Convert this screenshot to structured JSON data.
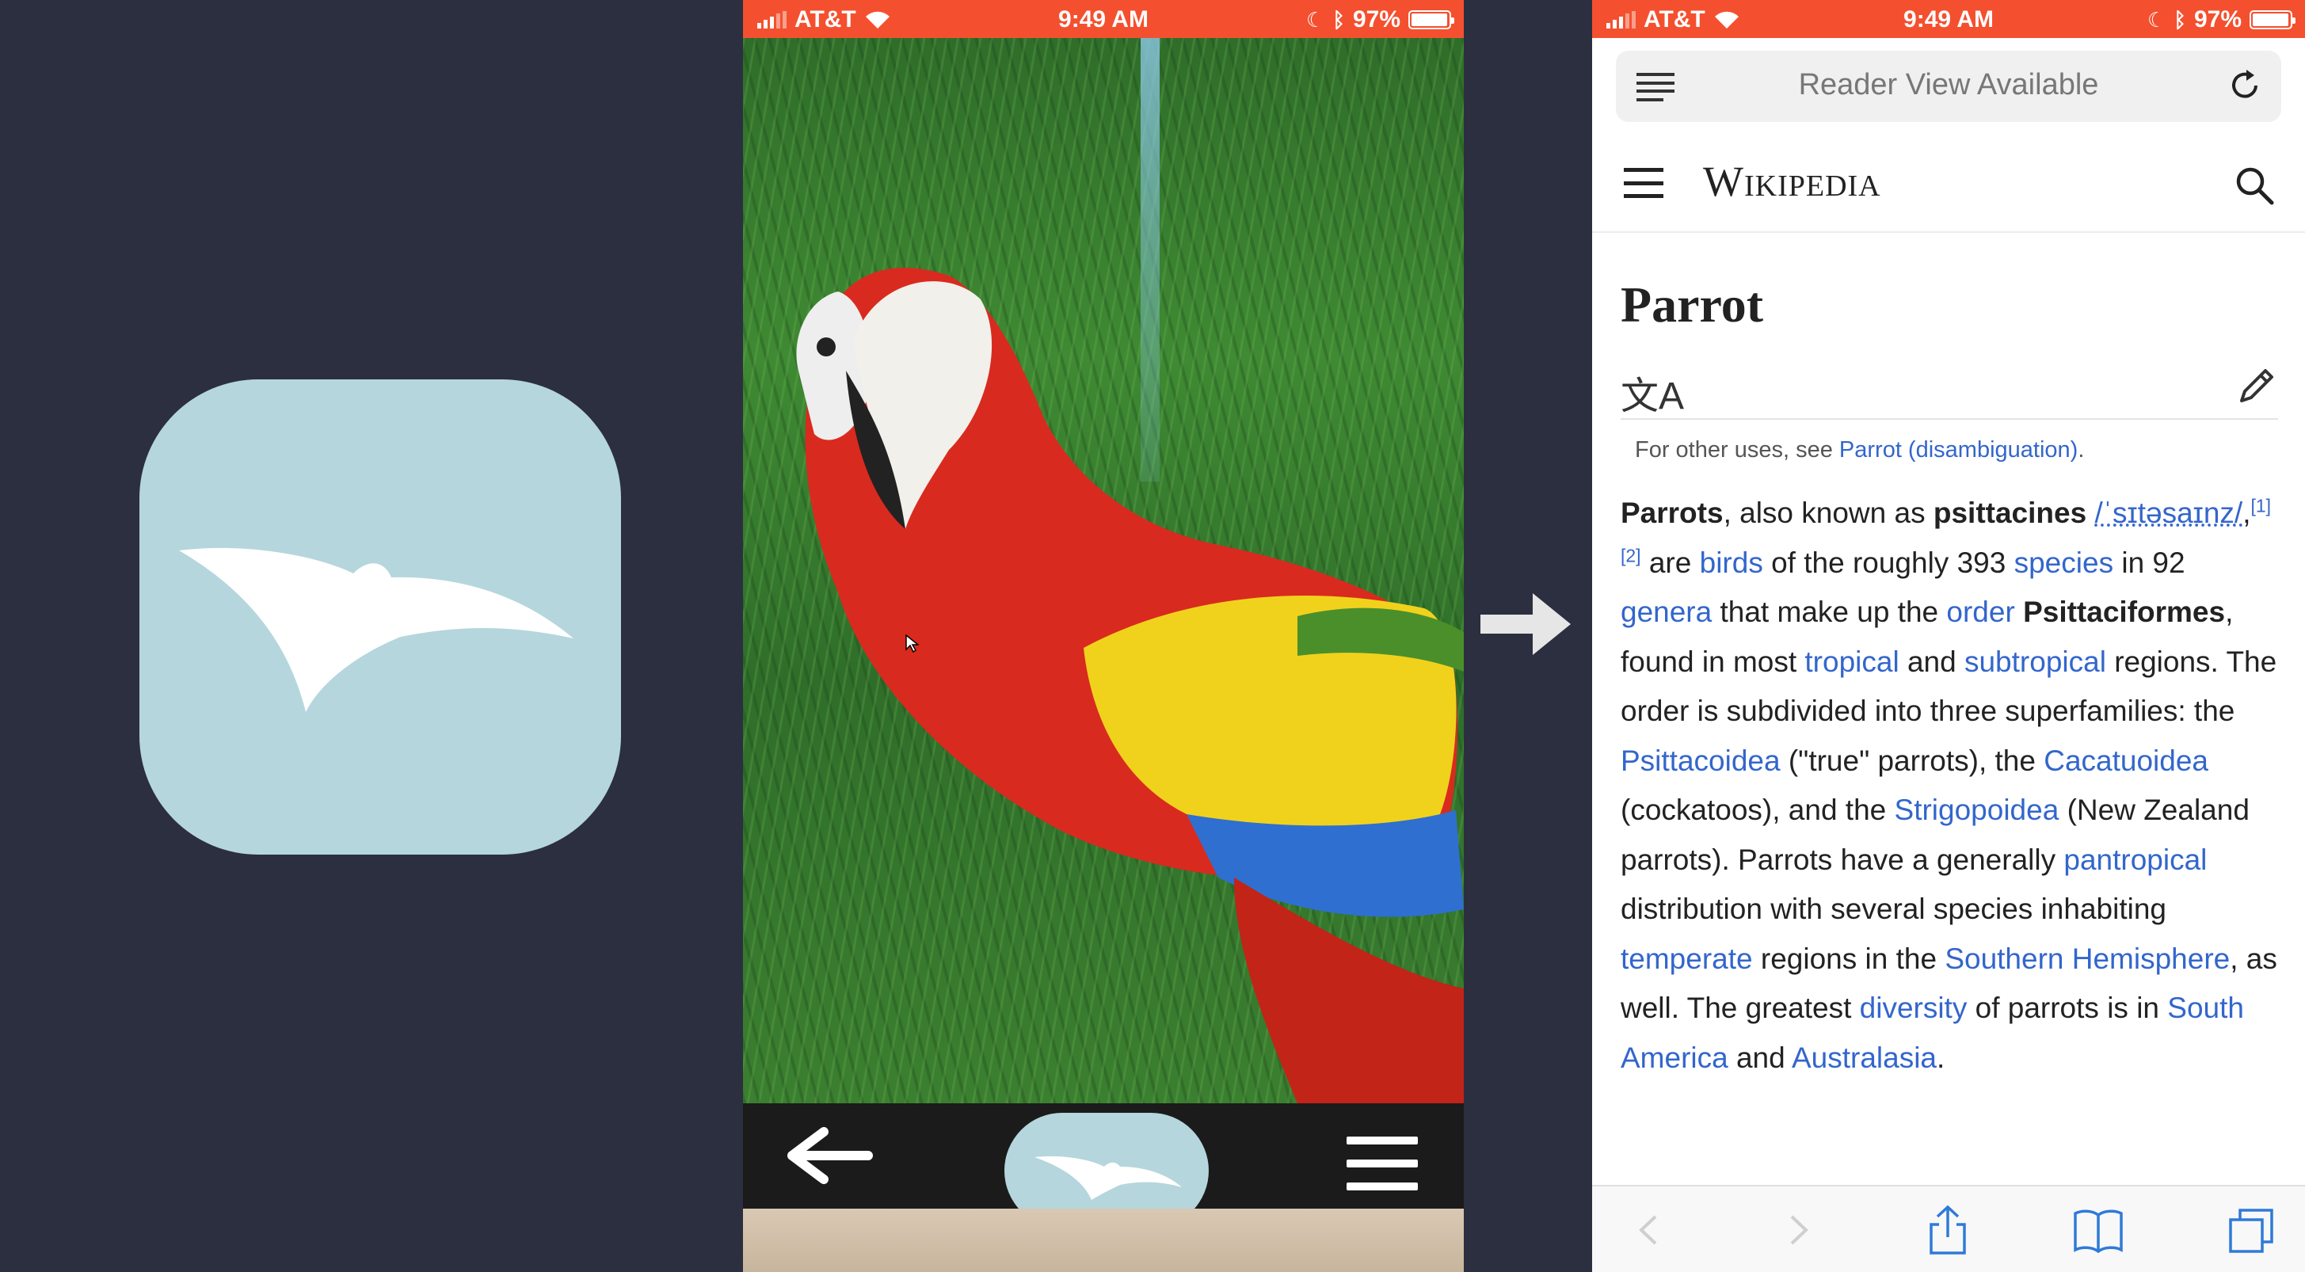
{
  "colors": {
    "accent_blue": "#b5d6dd",
    "status_bar": "#f4502f",
    "link": "#3366cc",
    "background": "#2c2f3f"
  },
  "app_icon": {
    "icon": "pterodactyl-bird-icon"
  },
  "camera_phone": {
    "status": {
      "carrier": "AT&T",
      "time": "9:49 AM",
      "battery": "97%",
      "battery_level": 0.97
    },
    "toolbar": {
      "back_icon": "arrow-left-icon",
      "capture_icon": "bird-icon",
      "menu_icon": "hamburger-icon"
    }
  },
  "transition_icon": "arrow-right-icon",
  "safari_phone": {
    "status": {
      "carrier": "AT&T",
      "time": "9:49 AM",
      "battery": "97%",
      "battery_level": 0.97
    },
    "address_bar": {
      "text": "Reader View Available",
      "reader_icon": "reader-icon",
      "reload_icon": "reload-icon"
    },
    "wiki": {
      "logo": "Wikipedia",
      "title": "Parrot",
      "hatnote_prefix": "For other uses, see ",
      "hatnote_link": "Parrot (disambiguation)",
      "hatnote_suffix": ".",
      "lead": {
        "b1": "Parrots",
        "t1": ", also known as ",
        "b2": "psittacines",
        "ipa": "/ˈsɪtəsaɪnz/",
        "t2": ",",
        "sup": "[1][2]",
        "t3": " are ",
        "l_birds": "birds",
        "t4": " of the roughly 393 ",
        "l_species": "species",
        "t5": " in 92 ",
        "l_genera": "genera",
        "t6": " that make up the ",
        "l_order": "order",
        "b3": "Psittaciformes",
        "t7": ", found in most ",
        "l_tropical": "tropical",
        "t8": " and ",
        "l_subtropical": "subtropical",
        "t9": " regions. The order is subdivided into three superfamilies: the ",
        "l_psittacoidea": "Psittacoidea",
        "t10": " (\"true\" parrots), the ",
        "l_cacatuoidea": "Cacatuoidea",
        "t11": " (cockatoos), and the ",
        "l_strigopoidea": "Strigopoidea",
        "t12": " (New Zealand parrots). Parrots have a generally ",
        "l_pantropical": "pantropical",
        "t13": " distribution with several species inhabiting ",
        "l_temperate": "temperate",
        "t14": " regions in the ",
        "l_southern": "Southern Hemisphere",
        "t15": ", as well. The greatest ",
        "l_diversity": "diversity",
        "t16": " of parrots is in ",
        "l_south_america": "South America",
        "t17": " and ",
        "l_australasia": "Australasia",
        "t18": "."
      }
    },
    "toolbar": {
      "icons": [
        "back-icon",
        "forward-icon",
        "share-icon",
        "bookmarks-icon",
        "tabs-icon"
      ]
    }
  }
}
